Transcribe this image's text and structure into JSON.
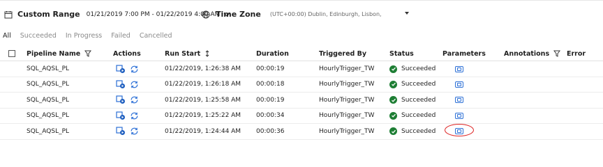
{
  "toolbar": {
    "range_label": "Custom Range",
    "range_value": "01/21/2019 7:00 PM - 01/22/2019 4:00 AM",
    "timezone_label": "Time Zone",
    "timezone_value": "(UTC+00:00) Dublin, Edinburgh, Lisbon,"
  },
  "tabs": [
    {
      "label": "All",
      "active": true
    },
    {
      "label": "Succeeded"
    },
    {
      "label": "In Progress"
    },
    {
      "label": "Failed"
    },
    {
      "label": "Cancelled"
    }
  ],
  "columns": [
    "Pipeline Name",
    "Actions",
    "Run Start",
    "Duration",
    "Triggered By",
    "Status",
    "Parameters",
    "Annotations",
    "Error"
  ],
  "rows": [
    {
      "name": "SQL_AQSL_PL",
      "start": "01/22/2019, 1:26:38 AM",
      "duration": "00:00:19",
      "trigger": "HourlyTrigger_TW",
      "status": "Succeeded"
    },
    {
      "name": "SQL_AQSL_PL",
      "start": "01/22/2019, 1:26:18 AM",
      "duration": "00:00:18",
      "trigger": "HourlyTrigger_TW",
      "status": "Succeeded"
    },
    {
      "name": "SQL_AQSL_PL",
      "start": "01/22/2019, 1:25:58 AM",
      "duration": "00:00:19",
      "trigger": "HourlyTrigger_TW",
      "status": "Succeeded"
    },
    {
      "name": "SQL_AQSL_PL",
      "start": "01/22/2019, 1:25:22 AM",
      "duration": "00:00:34",
      "trigger": "HourlyTrigger_TW",
      "status": "Succeeded"
    },
    {
      "name": "SQL_AQSL_PL",
      "start": "01/22/2019, 1:24:44 AM",
      "duration": "00:00:36",
      "trigger": "HourlyTrigger_TW",
      "status": "Succeeded"
    }
  ],
  "colors": {
    "accent": "#2b6fd6",
    "success": "#1e7e34",
    "highlight": "#dd2222"
  },
  "icons": [
    "calendar-icon",
    "chevron-down-icon",
    "globe-icon",
    "filter-icon",
    "sort-icon",
    "view-activity-icon",
    "rerun-icon",
    "success-icon",
    "parameters-icon"
  ]
}
